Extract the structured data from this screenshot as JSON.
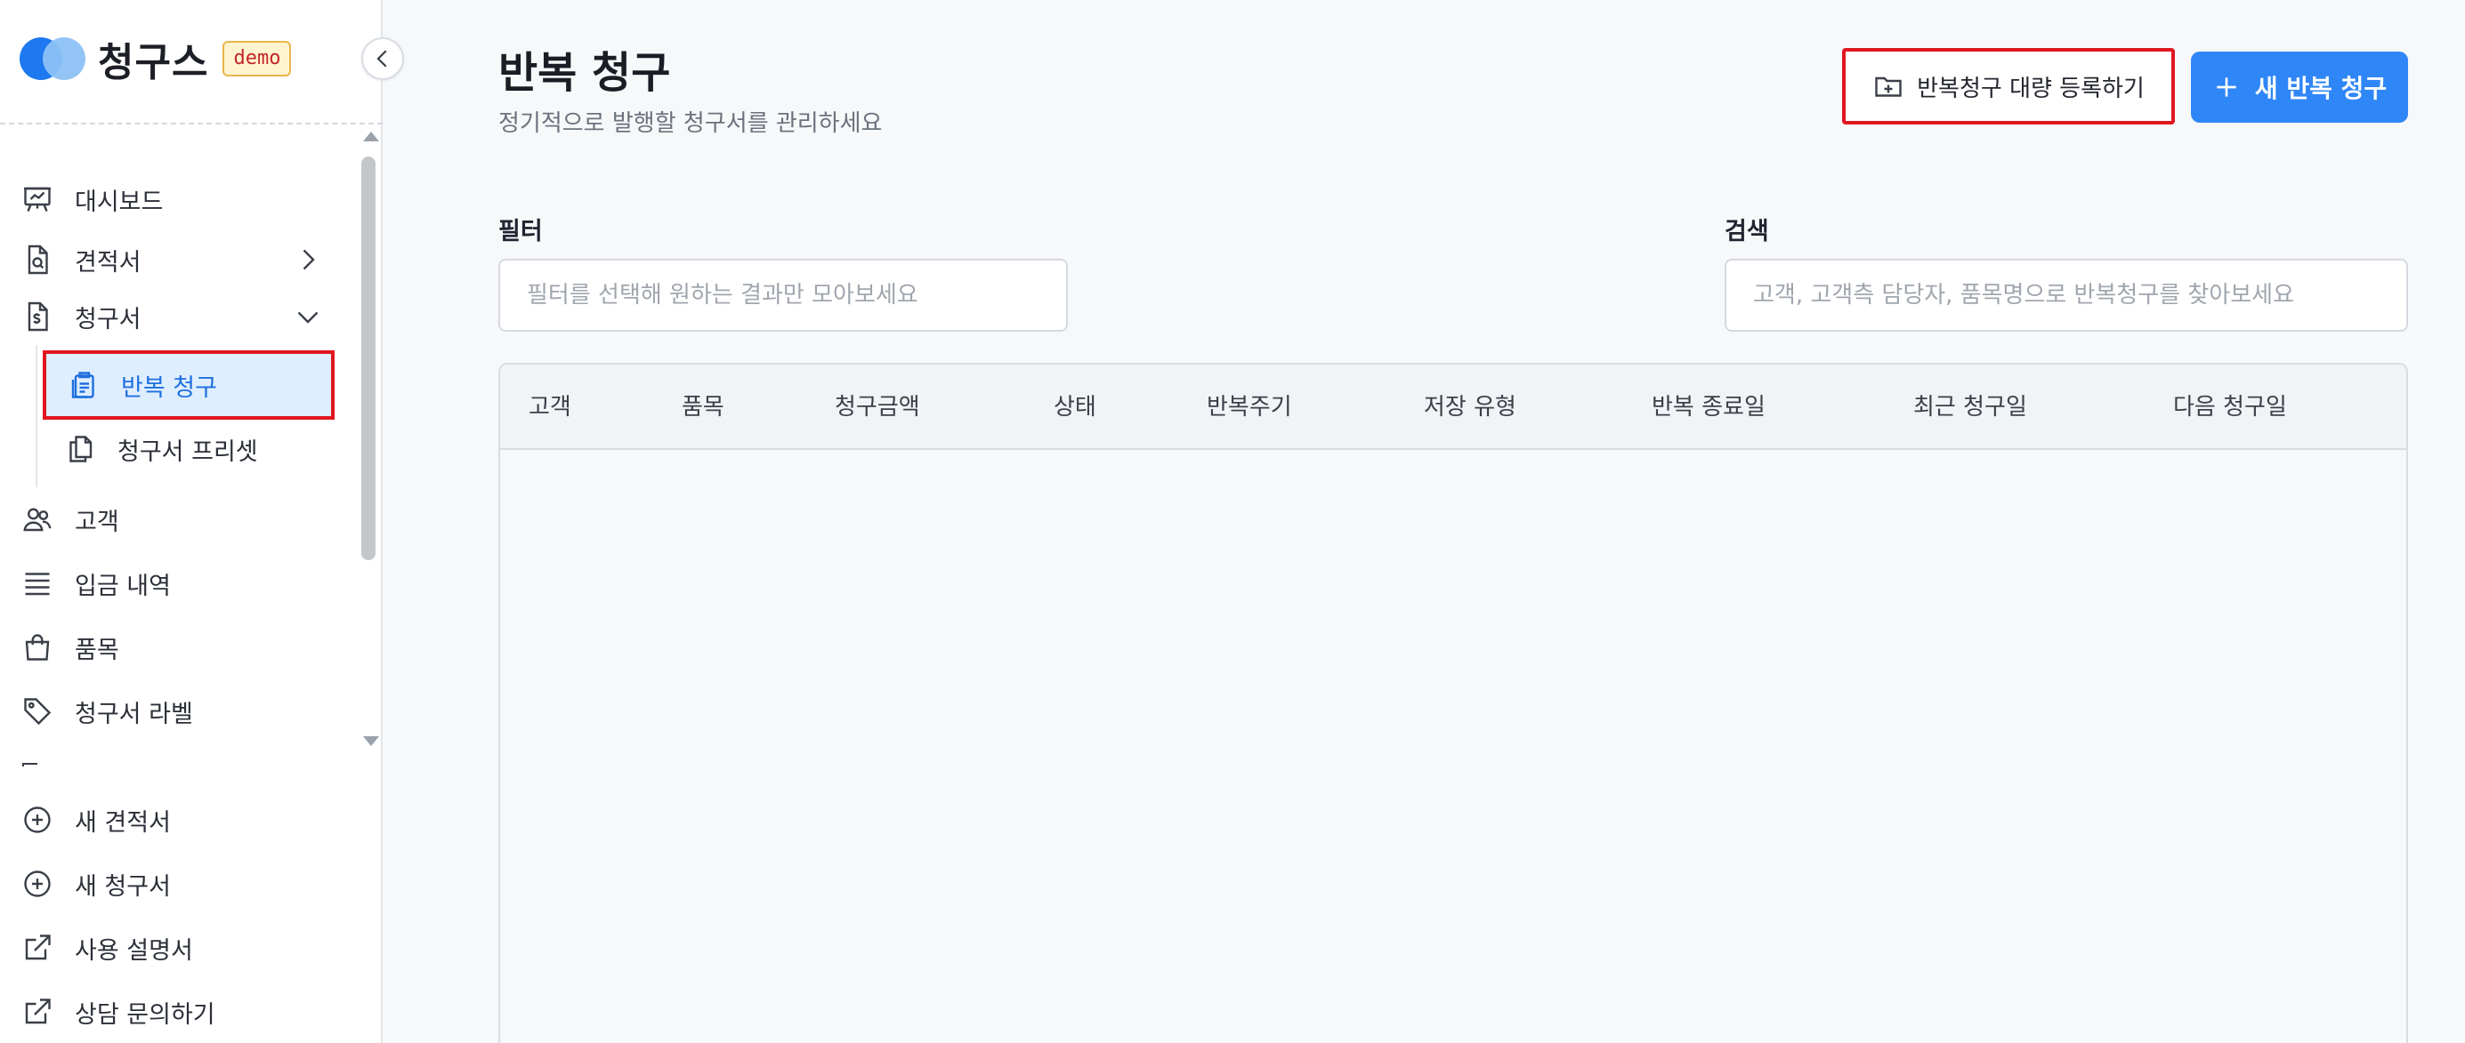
{
  "brand": {
    "name": "청구스",
    "badge": "demo"
  },
  "sidebar": {
    "items": [
      {
        "label": "대시보드",
        "icon": "presentation-board-icon"
      },
      {
        "label": "견적서",
        "icon": "document-search-icon"
      },
      {
        "label": "청구서",
        "icon": "invoice-dollar-icon"
      },
      {
        "label": "반복 청구",
        "icon": "clipboard-icon"
      },
      {
        "label": "청구서 프리셋",
        "icon": "copy-files-icon"
      },
      {
        "label": "고객",
        "icon": "users-icon"
      },
      {
        "label": "입금 내역",
        "icon": "list-lines-icon"
      },
      {
        "label": "품목",
        "icon": "shopping-bag-icon"
      },
      {
        "label": "청구서 라벨",
        "icon": "tag-icon"
      }
    ],
    "bottom_items": [
      {
        "label": "새 견적서",
        "icon": "plus-circle-icon"
      },
      {
        "label": "새 청구서",
        "icon": "plus-circle-icon"
      },
      {
        "label": "사용 설명서",
        "icon": "external-link-icon"
      },
      {
        "label": "상담 문의하기",
        "icon": "external-link-icon"
      }
    ]
  },
  "header": {
    "title": "반복 청구",
    "subtitle": "정기적으로 발행할 청구서를 관리하세요",
    "bulk_button": "반복청구 대량 등록하기",
    "new_button": "새 반복 청구"
  },
  "filter": {
    "label": "필터",
    "placeholder": "필터를 선택해 원하는 결과만 모아보세요"
  },
  "search": {
    "label": "검색",
    "placeholder": "고객, 고객측 담당자, 품목명으로 반복청구를 찾아보세요"
  },
  "table": {
    "columns": [
      "고객",
      "품목",
      "청구금액",
      "상태",
      "반복주기",
      "저장 유형",
      "반복 종료일",
      "최근 청구일",
      "다음 청구일"
    ]
  },
  "colors": {
    "accent": "#2f86f6",
    "highlight": "#e0161e",
    "active_bg": "#dfeeff"
  }
}
